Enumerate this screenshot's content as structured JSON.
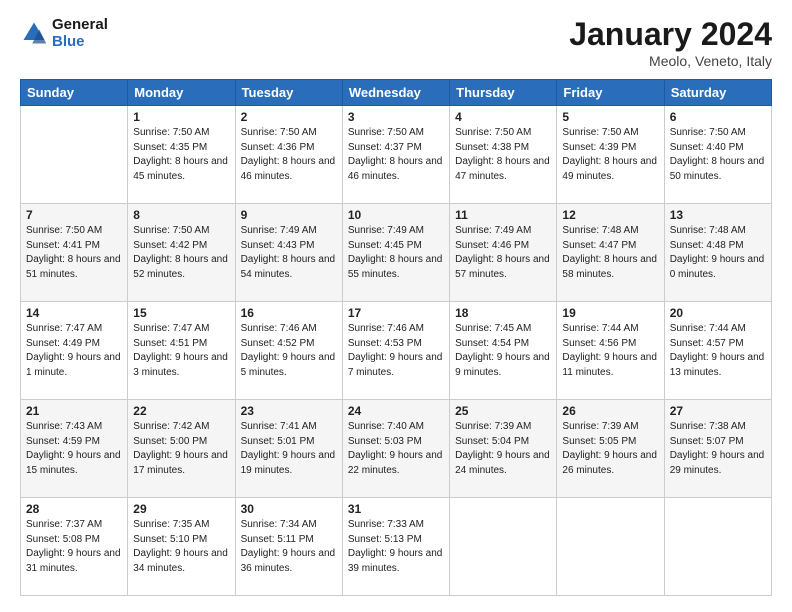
{
  "header": {
    "logo_line1": "General",
    "logo_line2": "Blue",
    "month_title": "January 2024",
    "location": "Meolo, Veneto, Italy"
  },
  "days_of_week": [
    "Sunday",
    "Monday",
    "Tuesday",
    "Wednesday",
    "Thursday",
    "Friday",
    "Saturday"
  ],
  "weeks": [
    [
      {
        "day": "",
        "sunrise": "",
        "sunset": "",
        "daylight": ""
      },
      {
        "day": "1",
        "sunrise": "Sunrise: 7:50 AM",
        "sunset": "Sunset: 4:35 PM",
        "daylight": "Daylight: 8 hours and 45 minutes."
      },
      {
        "day": "2",
        "sunrise": "Sunrise: 7:50 AM",
        "sunset": "Sunset: 4:36 PM",
        "daylight": "Daylight: 8 hours and 46 minutes."
      },
      {
        "day": "3",
        "sunrise": "Sunrise: 7:50 AM",
        "sunset": "Sunset: 4:37 PM",
        "daylight": "Daylight: 8 hours and 46 minutes."
      },
      {
        "day": "4",
        "sunrise": "Sunrise: 7:50 AM",
        "sunset": "Sunset: 4:38 PM",
        "daylight": "Daylight: 8 hours and 47 minutes."
      },
      {
        "day": "5",
        "sunrise": "Sunrise: 7:50 AM",
        "sunset": "Sunset: 4:39 PM",
        "daylight": "Daylight: 8 hours and 49 minutes."
      },
      {
        "day": "6",
        "sunrise": "Sunrise: 7:50 AM",
        "sunset": "Sunset: 4:40 PM",
        "daylight": "Daylight: 8 hours and 50 minutes."
      }
    ],
    [
      {
        "day": "7",
        "sunrise": "Sunrise: 7:50 AM",
        "sunset": "Sunset: 4:41 PM",
        "daylight": "Daylight: 8 hours and 51 minutes."
      },
      {
        "day": "8",
        "sunrise": "Sunrise: 7:50 AM",
        "sunset": "Sunset: 4:42 PM",
        "daylight": "Daylight: 8 hours and 52 minutes."
      },
      {
        "day": "9",
        "sunrise": "Sunrise: 7:49 AM",
        "sunset": "Sunset: 4:43 PM",
        "daylight": "Daylight: 8 hours and 54 minutes."
      },
      {
        "day": "10",
        "sunrise": "Sunrise: 7:49 AM",
        "sunset": "Sunset: 4:45 PM",
        "daylight": "Daylight: 8 hours and 55 minutes."
      },
      {
        "day": "11",
        "sunrise": "Sunrise: 7:49 AM",
        "sunset": "Sunset: 4:46 PM",
        "daylight": "Daylight: 8 hours and 57 minutes."
      },
      {
        "day": "12",
        "sunrise": "Sunrise: 7:48 AM",
        "sunset": "Sunset: 4:47 PM",
        "daylight": "Daylight: 8 hours and 58 minutes."
      },
      {
        "day": "13",
        "sunrise": "Sunrise: 7:48 AM",
        "sunset": "Sunset: 4:48 PM",
        "daylight": "Daylight: 9 hours and 0 minutes."
      }
    ],
    [
      {
        "day": "14",
        "sunrise": "Sunrise: 7:47 AM",
        "sunset": "Sunset: 4:49 PM",
        "daylight": "Daylight: 9 hours and 1 minute."
      },
      {
        "day": "15",
        "sunrise": "Sunrise: 7:47 AM",
        "sunset": "Sunset: 4:51 PM",
        "daylight": "Daylight: 9 hours and 3 minutes."
      },
      {
        "day": "16",
        "sunrise": "Sunrise: 7:46 AM",
        "sunset": "Sunset: 4:52 PM",
        "daylight": "Daylight: 9 hours and 5 minutes."
      },
      {
        "day": "17",
        "sunrise": "Sunrise: 7:46 AM",
        "sunset": "Sunset: 4:53 PM",
        "daylight": "Daylight: 9 hours and 7 minutes."
      },
      {
        "day": "18",
        "sunrise": "Sunrise: 7:45 AM",
        "sunset": "Sunset: 4:54 PM",
        "daylight": "Daylight: 9 hours and 9 minutes."
      },
      {
        "day": "19",
        "sunrise": "Sunrise: 7:44 AM",
        "sunset": "Sunset: 4:56 PM",
        "daylight": "Daylight: 9 hours and 11 minutes."
      },
      {
        "day": "20",
        "sunrise": "Sunrise: 7:44 AM",
        "sunset": "Sunset: 4:57 PM",
        "daylight": "Daylight: 9 hours and 13 minutes."
      }
    ],
    [
      {
        "day": "21",
        "sunrise": "Sunrise: 7:43 AM",
        "sunset": "Sunset: 4:59 PM",
        "daylight": "Daylight: 9 hours and 15 minutes."
      },
      {
        "day": "22",
        "sunrise": "Sunrise: 7:42 AM",
        "sunset": "Sunset: 5:00 PM",
        "daylight": "Daylight: 9 hours and 17 minutes."
      },
      {
        "day": "23",
        "sunrise": "Sunrise: 7:41 AM",
        "sunset": "Sunset: 5:01 PM",
        "daylight": "Daylight: 9 hours and 19 minutes."
      },
      {
        "day": "24",
        "sunrise": "Sunrise: 7:40 AM",
        "sunset": "Sunset: 5:03 PM",
        "daylight": "Daylight: 9 hours and 22 minutes."
      },
      {
        "day": "25",
        "sunrise": "Sunrise: 7:39 AM",
        "sunset": "Sunset: 5:04 PM",
        "daylight": "Daylight: 9 hours and 24 minutes."
      },
      {
        "day": "26",
        "sunrise": "Sunrise: 7:39 AM",
        "sunset": "Sunset: 5:05 PM",
        "daylight": "Daylight: 9 hours and 26 minutes."
      },
      {
        "day": "27",
        "sunrise": "Sunrise: 7:38 AM",
        "sunset": "Sunset: 5:07 PM",
        "daylight": "Daylight: 9 hours and 29 minutes."
      }
    ],
    [
      {
        "day": "28",
        "sunrise": "Sunrise: 7:37 AM",
        "sunset": "Sunset: 5:08 PM",
        "daylight": "Daylight: 9 hours and 31 minutes."
      },
      {
        "day": "29",
        "sunrise": "Sunrise: 7:35 AM",
        "sunset": "Sunset: 5:10 PM",
        "daylight": "Daylight: 9 hours and 34 minutes."
      },
      {
        "day": "30",
        "sunrise": "Sunrise: 7:34 AM",
        "sunset": "Sunset: 5:11 PM",
        "daylight": "Daylight: 9 hours and 36 minutes."
      },
      {
        "day": "31",
        "sunrise": "Sunrise: 7:33 AM",
        "sunset": "Sunset: 5:13 PM",
        "daylight": "Daylight: 9 hours and 39 minutes."
      },
      {
        "day": "",
        "sunrise": "",
        "sunset": "",
        "daylight": ""
      },
      {
        "day": "",
        "sunrise": "",
        "sunset": "",
        "daylight": ""
      },
      {
        "day": "",
        "sunrise": "",
        "sunset": "",
        "daylight": ""
      }
    ]
  ]
}
